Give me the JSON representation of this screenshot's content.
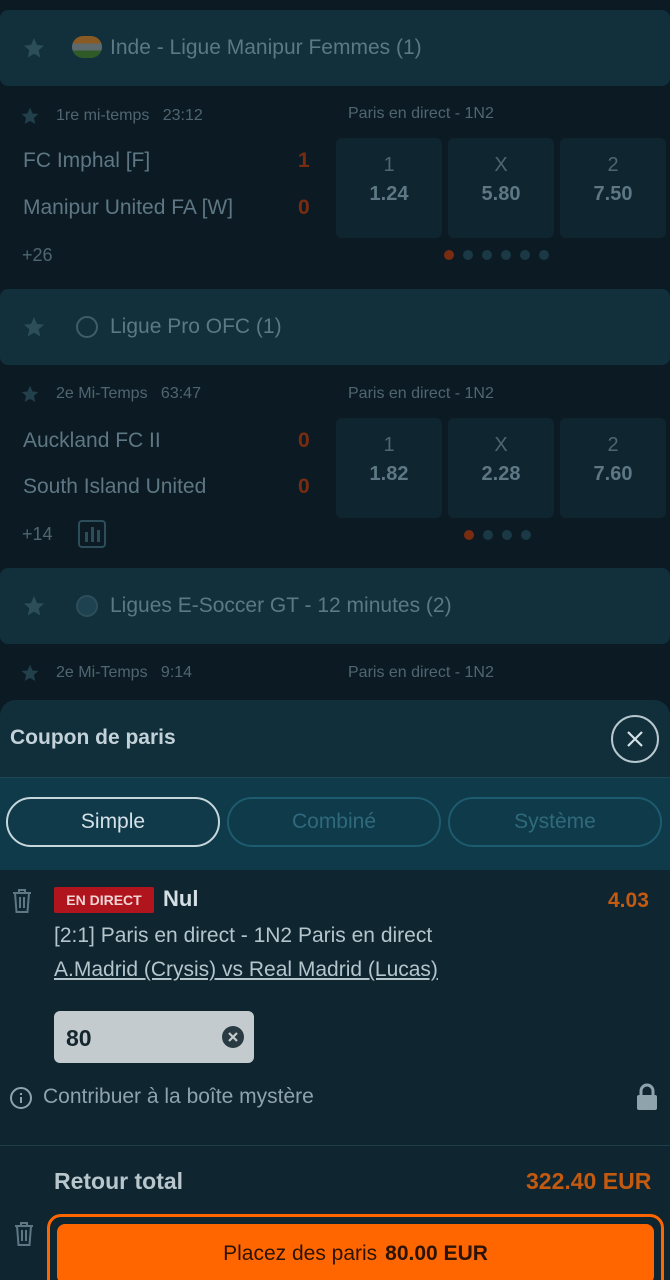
{
  "background_list": {
    "leagues": [
      {
        "name": "Inde - Ligue Manipur Femmes (1)"
      },
      {
        "name": "Ligue Pro OFC (1)"
      },
      {
        "name": "Ligues E-Soccer GT - 12 minutes (2)"
      }
    ],
    "matches": [
      {
        "status": "1re mi-temps",
        "clock": "23:12",
        "market": "Paris en direct - 1N2",
        "home": "FC Imphal [F]",
        "away": "Manipur United FA [W]",
        "home_score": "1",
        "away_score": "0",
        "odds": [
          {
            "label": "1",
            "value": "1.24"
          },
          {
            "label": "X",
            "value": "5.80"
          },
          {
            "label": "2",
            "value": "7.50"
          }
        ],
        "more": "+26"
      },
      {
        "status": "2e Mi-Temps",
        "clock": "63:47",
        "market": "Paris en direct - 1N2",
        "home": "Auckland FC II",
        "away": "South Island United",
        "home_score": "0",
        "away_score": "0",
        "odds": [
          {
            "label": "1",
            "value": "1.82"
          },
          {
            "label": "X",
            "value": "2.28"
          },
          {
            "label": "2",
            "value": "7.60"
          }
        ],
        "more": "+14"
      },
      {
        "status": "2e Mi-Temps",
        "clock": "9:14",
        "market": "Paris en direct - 1N2"
      }
    ]
  },
  "slip": {
    "title": "Coupon de paris",
    "tabs": [
      {
        "label": "Simple",
        "active": true
      },
      {
        "label": "Combiné",
        "active": false
      },
      {
        "label": "Système",
        "active": false
      }
    ],
    "bet": {
      "badge": "EN DIRECT",
      "selection": "Nul",
      "odd": "4.03",
      "market": "[2:1] Paris en direct - 1N2 Paris en direct",
      "event": "A.Madrid (Crysis) vs Real Madrid (Lucas)",
      "stake": "80"
    },
    "mystery_label": "Contribuer à la boîte mystère",
    "total_label": "Retour total",
    "total_value": "322.40 EUR",
    "place_label": "Placez des paris",
    "place_amount": "80.00 EUR"
  },
  "colors": {
    "accent": "#ff6600",
    "live": "#b0151e"
  }
}
